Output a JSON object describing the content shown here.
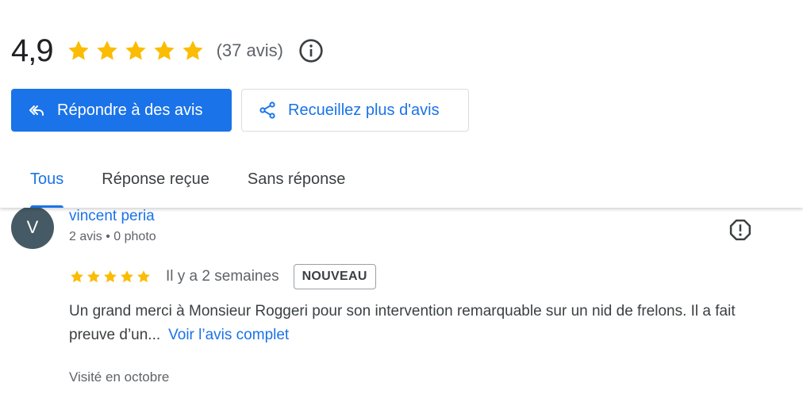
{
  "summary": {
    "rating": "4,9",
    "stars": 5,
    "count": "(37 avis)",
    "info_icon": "info-icon"
  },
  "actions": {
    "reply": {
      "label": "Répondre à des avis",
      "icon": "reply-arrow-icon"
    },
    "collect": {
      "label": "Recueillez plus d'avis",
      "icon": "share-icon"
    }
  },
  "tabs": [
    {
      "label": "Tous",
      "active": true
    },
    {
      "label": "Réponse reçue",
      "active": false
    },
    {
      "label": "Sans réponse",
      "active": false
    }
  ],
  "review": {
    "avatar_letter": "V",
    "name": "vincent peria",
    "meta": "2 avis • 0 photo",
    "stars": 5,
    "time": "Il y a 2 semaines",
    "badge": "NOUVEAU",
    "text": "Un grand merci à Monsieur Roggeri pour son intervention remarquable sur un nid de frelons. Il a fait preuve d’un...",
    "more_link": "Voir l’avis complet",
    "visited": "Visité en octobre"
  },
  "colors": {
    "accent": "#1a73e8",
    "star": "#fbbc04",
    "avatar": "#455a64"
  }
}
